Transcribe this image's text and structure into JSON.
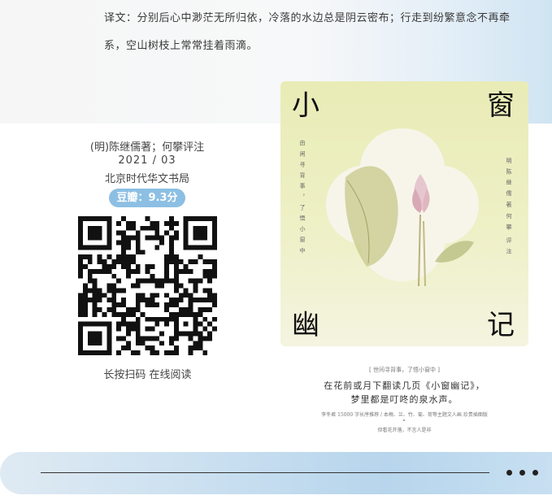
{
  "translation": {
    "text": "译文：分别后心中渺茫无所归依，冷落的水边总是阴云密布；行走到纷繁意念不再牵系，空山树枝上常常挂着雨滴。"
  },
  "book": {
    "author": "(明)陈继儒著；何攀评注",
    "date": "2021 / 03",
    "publisher": "北京时代华文书局",
    "rating": "豆瓣：9.3分",
    "scan_hint": "长按扫码 在线阅读"
  },
  "cover": {
    "char_1": "小",
    "char_2": "窗",
    "char_3": "幽",
    "char_4": "记",
    "left_vertical": "由 闲 寻 背 事 ， 了 悟 小 窗 中",
    "right_vertical_1": "明 陈 继 儒",
    "right_vertical_2": "著",
    "right_vertical_3": "何 攀",
    "right_vertical_4": "评 注",
    "tagline": "[ 世间寻背事，了悟小窗中 ]",
    "slogan_1": "在花前或月下翻读几页《小窗幽记》，",
    "slogan_2": "梦里都是叮咚的泉水声。",
    "desc_1": "李冬君 15000 字长序推荐 / 本梅、兰、竹、菊、荷等主题文人画 珍贵插图版",
    "desc_2": "但看花开落，不言人是非"
  },
  "colors": {
    "rating_badge": "#8cbfe3",
    "cover_bg": "#e9ecb6",
    "band_blue": "#b7d5ec"
  }
}
